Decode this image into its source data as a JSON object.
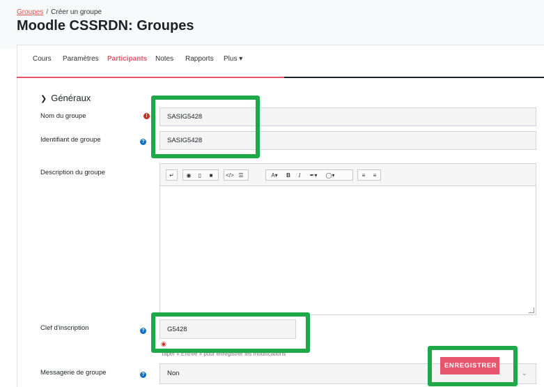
{
  "breadcrumb": {
    "link": "Groupes",
    "separator": "/",
    "current": "Créer un groupe"
  },
  "page_title": "Moodle CSSRDN: Groupes",
  "nav_tabs": [
    {
      "label": "Cours"
    },
    {
      "label": "Paramètres"
    },
    {
      "label": "Participants",
      "active": true
    },
    {
      "label": "Notes"
    },
    {
      "label": "Rapports"
    },
    {
      "label": "Plus ▾"
    }
  ],
  "section": {
    "title": "Généraux"
  },
  "fields": {
    "group_name": {
      "label": "Nom du groupe",
      "value": "SASIG5428"
    },
    "group_id": {
      "label": "Identifiant de groupe",
      "value": "SASIG5428"
    },
    "description": {
      "label": "Description du groupe",
      "value": ""
    },
    "enrolment_key": {
      "label": "Clef d'inscription",
      "value": "G5428",
      "hint": "Taper « Entrée » pour enregistrer les modifications"
    },
    "group_messaging": {
      "label": "Messagerie de groupe",
      "value": "Non"
    }
  },
  "save_button": {
    "label": "ENREGISTRER"
  },
  "colors": {
    "accent": "#e8546c",
    "highlight": "#1ea84a",
    "help": "#0f6fc5",
    "required": "#ca3120"
  }
}
